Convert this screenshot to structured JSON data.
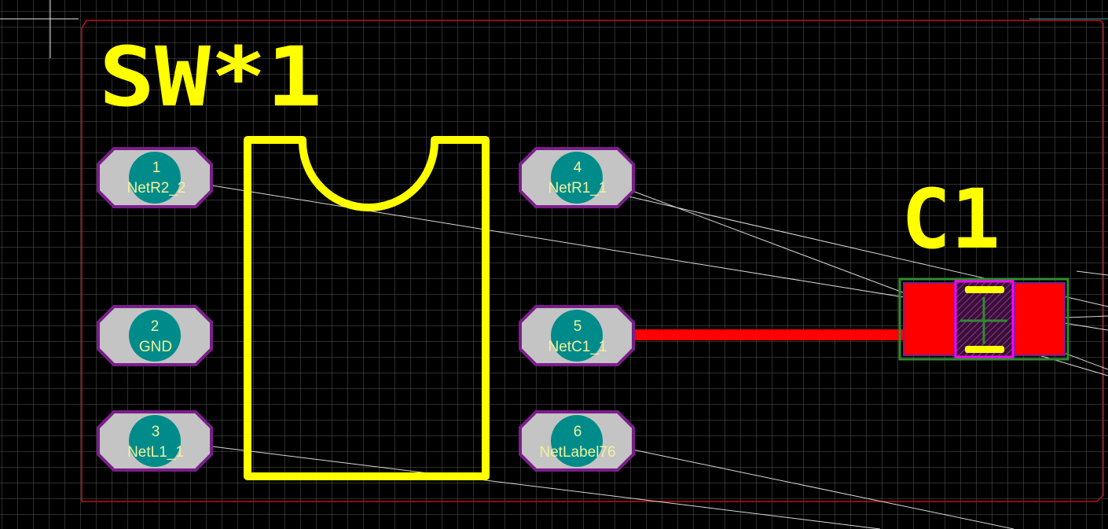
{
  "board": {
    "background_color": "#000000",
    "grid_color": "#5a5a5a",
    "outline_color": "#c0101a",
    "silkscreen_color": "#ffff00",
    "pad_fill_color": "#c4c4c4",
    "pad_outline_color": "#7a1e8a",
    "drill_color": "#008b8b",
    "track_color": "#ff0000",
    "ratsnest_color": "#d8d8d8"
  },
  "components": {
    "sw1": {
      "designator": "SW*1",
      "pads": [
        {
          "number": "1",
          "net": "NetR2_2"
        },
        {
          "number": "2",
          "net": "GND"
        },
        {
          "number": "3",
          "net": "NetL1_1"
        },
        {
          "number": "4",
          "net": "NetR1_1"
        },
        {
          "number": "5",
          "net": "NetC1_1"
        },
        {
          "number": "6",
          "net": "NetLabel76"
        }
      ]
    },
    "c1": {
      "designator": "C1",
      "pad_color": "#ff0000",
      "body_color": "#ff00ff",
      "courtyard_color": "#2e8b2e"
    }
  }
}
